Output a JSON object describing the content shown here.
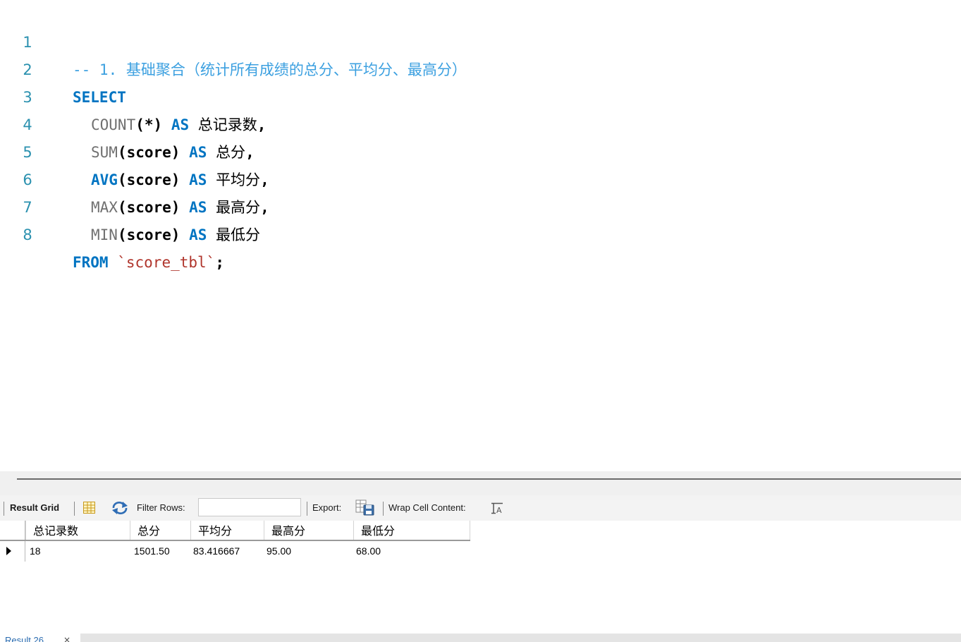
{
  "editor": {
    "lines": [
      {
        "num": "1",
        "comment": "-- 1. 基础聚合（统计所有成绩的总分、平均分、最高分）"
      },
      {
        "num": "2",
        "kw": "SELECT"
      },
      {
        "num": "3",
        "fn": "COUNT",
        "args": "(*)",
        "as": "AS",
        "alias": "总记录数",
        "tail": ","
      },
      {
        "num": "4",
        "fn": "SUM",
        "args": "(score)",
        "as": "AS",
        "alias": "总分",
        "tail": ","
      },
      {
        "num": "5",
        "fn": "AVG",
        "args": "(score)",
        "as": "AS",
        "alias": "平均分",
        "tail": ","
      },
      {
        "num": "6",
        "fn": "MAX",
        "args": "(score)",
        "as": "AS",
        "alias": "最高分",
        "tail": ","
      },
      {
        "num": "7",
        "fn": "MIN",
        "args": "(score)",
        "as": "AS",
        "alias": "最低分",
        "tail": ""
      },
      {
        "num": "8",
        "kw": "FROM",
        "table": "`score_tbl`",
        "tail": ";"
      }
    ]
  },
  "toolbar": {
    "result_grid_label": "Result Grid",
    "filter_rows_label": "Filter Rows:",
    "filter_rows_value": "",
    "export_label": "Export:",
    "wrap_label": "Wrap Cell Content:",
    "icons": [
      "grid-view-icon",
      "refresh-icon",
      "export-icon",
      "wrap-text-icon"
    ]
  },
  "grid": {
    "columns": [
      "总记录数",
      "总分",
      "平均分",
      "最高分",
      "最低分"
    ],
    "rows": [
      [
        "18",
        "1501.50",
        "83.416667",
        "95.00",
        "68.00"
      ]
    ]
  },
  "tabs": {
    "result_tab_label": "Result 26",
    "close_glyph": "×"
  },
  "colors": {
    "keyword": "#0074c2",
    "comment": "#3ca0e0",
    "function": "#707070",
    "string": "#b0352c",
    "line_number": "#2b91af"
  }
}
